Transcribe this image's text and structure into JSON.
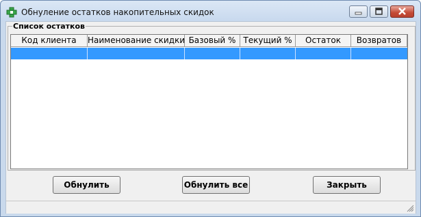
{
  "window": {
    "title": "Обнуление остатков накопительных скидок",
    "app_icon": "pharmacy-cross-icon",
    "controls": [
      "minimize-icon",
      "maximize-icon",
      "close-icon"
    ]
  },
  "group": {
    "label": "Список остатков"
  },
  "table": {
    "columns": [
      "Код клиента",
      "Наименование скидки",
      "Базовый %",
      "Текущий %",
      "Остаток",
      "Возвратов"
    ],
    "rows": [
      [
        "",
        "",
        "",
        "",
        "",
        ""
      ]
    ],
    "selection_color": "#3399ff"
  },
  "buttons": {
    "reset": "Обнулить",
    "reset_all": "Обнулить все",
    "close": "Закрыть"
  }
}
